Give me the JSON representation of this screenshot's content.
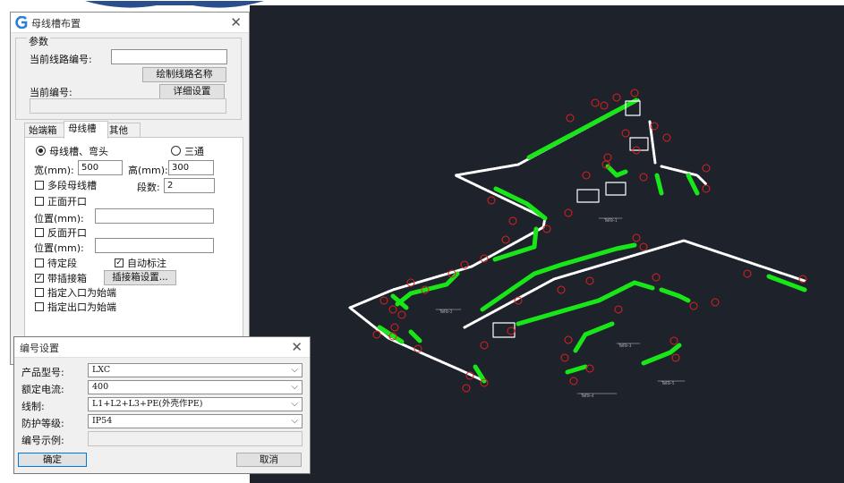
{
  "dialog_main": {
    "title": "母线槽布置",
    "group_title": "参数",
    "current_line_label": "当前线路编号:",
    "current_line_value": "",
    "draw_name_button": "绘制线路名称",
    "current_no_label": "当前编号:",
    "detail_button": "详细设置",
    "tabs": [
      "始端箱",
      "母线槽",
      "其他"
    ],
    "radio_busbar": "母线槽、弯头",
    "radio_tee": "三通",
    "width_label": "宽(mm):",
    "width_value": "500",
    "height_label": "高(mm):",
    "height_value": "300",
    "multi_busbar": "多段母线槽",
    "segments_label": "段数:",
    "segments_value": "2",
    "front_open": "正面开口",
    "front_pos_label": "位置(mm):",
    "back_open": "反面开口",
    "back_pos_label": "位置(mm):",
    "pending_segment": "待定段",
    "auto_label": "自动标注",
    "with_plugbox": "带插接箱",
    "plugbox_button": "插接箱设置...",
    "entry_as_start": "指定入口为始端",
    "exit_as_start": "指定出口为始端"
  },
  "dialog_numbering": {
    "title": "编号设置",
    "rows": [
      {
        "label": "产品型号:",
        "value": "LXC"
      },
      {
        "label": "额定电流:",
        "value": "400"
      },
      {
        "label": "线制:",
        "value": "L1+L2+L3+PE(外壳作PE)"
      },
      {
        "label": "防护等级:",
        "value": "IP54"
      }
    ],
    "example_label": "编号示例:",
    "example_value": "",
    "ok": "确定",
    "cancel": "取消"
  },
  "canvas_labels": {
    "l1": "TWFB—1",
    "l2": "TWFB—2",
    "l3": "TWFB—3",
    "l4": "TWFB—4",
    "l5": "TWFB—5"
  },
  "colors": {
    "canvas_bg": "#1e222b",
    "busbar": "#19e619",
    "callout": "#e02020"
  }
}
